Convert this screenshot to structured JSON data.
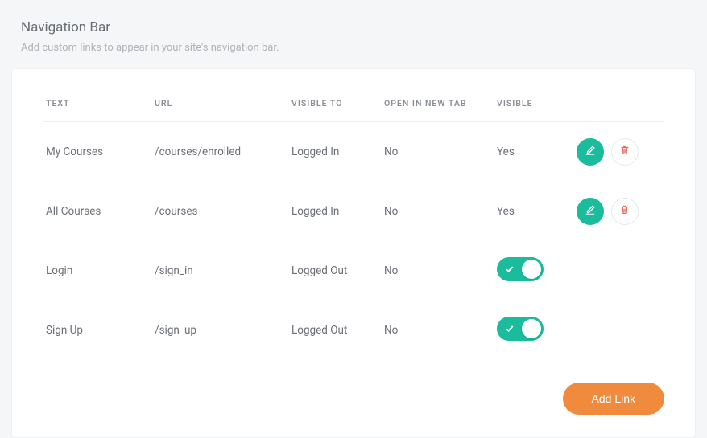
{
  "header": {
    "title": "Navigation Bar",
    "subtitle": "Add custom links to appear in your site's navigation bar."
  },
  "columns": {
    "text": "TEXT",
    "url": "URL",
    "visible_to": "VISIBLE TO",
    "open_new_tab": "OPEN IN NEW TAB",
    "visible": "VISIBLE"
  },
  "rows": [
    {
      "text": "My Courses",
      "url": "/courses/enrolled",
      "visible_to": "Logged In",
      "open_new_tab": "No",
      "visible_mode": "text",
      "visible": "Yes"
    },
    {
      "text": "All Courses",
      "url": "/courses",
      "visible_to": "Logged In",
      "open_new_tab": "No",
      "visible_mode": "text",
      "visible": "Yes"
    },
    {
      "text": "Login",
      "url": "/sign_in",
      "visible_to": "Logged Out",
      "open_new_tab": "No",
      "visible_mode": "toggle",
      "toggle_on": true
    },
    {
      "text": "Sign Up",
      "url": "/sign_up",
      "visible_to": "Logged Out",
      "open_new_tab": "No",
      "visible_mode": "toggle",
      "toggle_on": true
    }
  ],
  "actions": {
    "add_link": "Add Link"
  },
  "icons": {
    "edit": "edit-icon",
    "delete": "trash-icon",
    "check": "check-icon"
  }
}
